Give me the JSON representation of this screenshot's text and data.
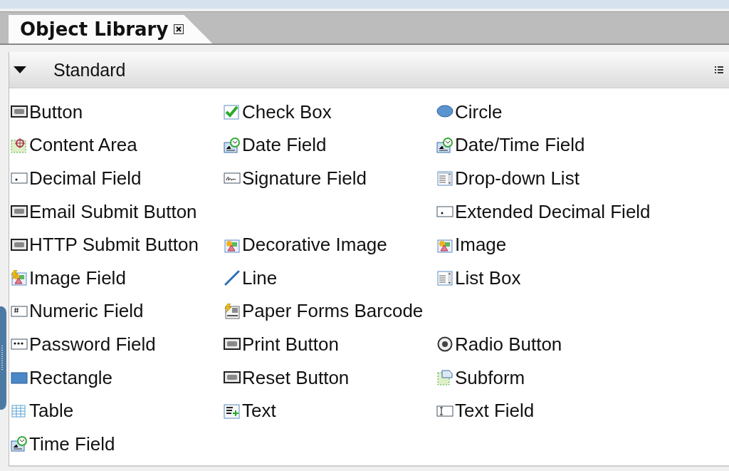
{
  "tab": {
    "title": "Object Library",
    "selected": true
  },
  "section": {
    "title": "Standard",
    "expanded": true
  },
  "columns": [
    [
      {
        "label": "Button",
        "kind": "ok"
      },
      {
        "label": "Content Area",
        "kind": "area"
      },
      {
        "label": "Decimal Field",
        "kind": "decimal"
      },
      {
        "label": "Email Submit Button",
        "kind": "ok"
      },
      {
        "label": "HTTP Submit Button",
        "kind": "ok"
      },
      {
        "label": "Image Field",
        "kind": "imagefield"
      },
      {
        "label": "Numeric Field",
        "kind": "numeric"
      },
      {
        "label": "Password Field",
        "kind": "password"
      },
      {
        "label": "Rectangle",
        "kind": "rect"
      },
      {
        "label": "Table",
        "kind": "table"
      },
      {
        "label": "Time Field",
        "kind": "clock"
      }
    ],
    [
      {
        "label": "Check Box",
        "kind": "check"
      },
      {
        "label": "Date Field",
        "kind": "clock"
      },
      {
        "label": "Signature Field",
        "kind": "signature"
      },
      {
        "label": "Decorative Image",
        "kind": "image",
        "gap_before": true
      },
      {
        "label": "Line",
        "kind": "line"
      },
      {
        "label": "Paper Forms Barcode",
        "kind": "barcode"
      },
      {
        "label": "Print Button",
        "kind": "ok"
      },
      {
        "label": "Reset Button",
        "kind": "ok"
      },
      {
        "label": "Text",
        "kind": "text"
      }
    ],
    [
      {
        "label": "Circle",
        "kind": "circle"
      },
      {
        "label": "Date/Time Field",
        "kind": "clock"
      },
      {
        "label": "Drop-down List",
        "kind": "dropdown"
      },
      {
        "label": "Extended Decimal Field",
        "kind": "decimal"
      },
      {
        "label": "Image",
        "kind": "image"
      },
      {
        "label": "List Box",
        "kind": "listbox"
      },
      {
        "label": "Radio Button",
        "kind": "radio",
        "gap_before": true
      },
      {
        "label": "Subform",
        "kind": "subform"
      },
      {
        "label": "Text Field",
        "kind": "textfield"
      }
    ]
  ]
}
